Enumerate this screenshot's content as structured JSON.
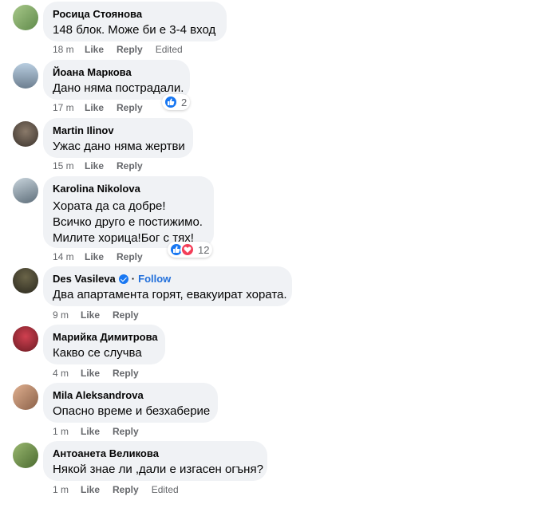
{
  "comments": [
    {
      "author": "Росица Стоянова",
      "text": [
        "148 блок. Може би е 3-4 вход"
      ],
      "time": "18 m",
      "like": "Like",
      "reply": "Reply",
      "edited": "Edited",
      "avatar_color": "#7aa36a"
    },
    {
      "author": "Йоана Маркова",
      "text": [
        "Дано няма пострадали."
      ],
      "time": "17 m",
      "like": "Like",
      "reply": "Reply",
      "reactions": {
        "types": [
          "like"
        ],
        "count": "2"
      },
      "avatar_color": "#8aa0b8"
    },
    {
      "author": "Martin Ilinov",
      "text": [
        "Ужас дано няма жертви"
      ],
      "time": "15 m",
      "like": "Like",
      "reply": "Reply",
      "avatar_color": "#5a5048"
    },
    {
      "author": "Karolina Nikolova",
      "text": [
        "Хората да са добре!",
        "Всичко друго е постижимо.",
        "Милите хорица!Бог с тях!"
      ],
      "time": "14 m",
      "like": "Like",
      "reply": "Reply",
      "reactions": {
        "types": [
          "like",
          "love"
        ],
        "count": "12"
      },
      "avatar_color": "#6b7c8c"
    },
    {
      "author": "Des Vasileva",
      "verified": true,
      "follow": "Follow",
      "text": [
        "Два апартамента горят, евакуират хората."
      ],
      "time": "9 m",
      "like": "Like",
      "reply": "Reply",
      "avatar_color": "#3b3a2e"
    },
    {
      "author": "Марийка Димитрова",
      "text": [
        "Какво се случва"
      ],
      "time": "4 m",
      "like": "Like",
      "reply": "Reply",
      "avatar_color": "#b03040"
    },
    {
      "author": "Mila Aleksandrova",
      "text": [
        "Опасно време и безхаберие"
      ],
      "time": "1 m",
      "like": "Like",
      "reply": "Reply",
      "avatar_color": "#c09070"
    },
    {
      "author": "Антоанета Великова",
      "text": [
        "Някой знае ли ,дали е изгасен огъня?"
      ],
      "time": "1 m",
      "like": "Like",
      "reply": "Reply",
      "edited": "Edited",
      "avatar_color": "#7a9a50"
    }
  ],
  "colors": {
    "bubble": "#f0f2f5",
    "meta": "#65676b",
    "link": "#216fdb",
    "like_reaction": "#1877f2",
    "love_reaction": "#f33e58"
  }
}
